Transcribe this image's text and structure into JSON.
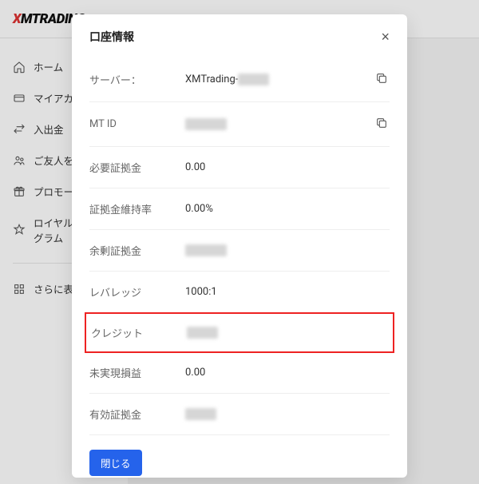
{
  "logo": {
    "prefix": "X",
    "rest": "MTRADING"
  },
  "sidebar": {
    "items": [
      {
        "label": "ホーム",
        "icon": "home-icon"
      },
      {
        "label": "マイアカウント",
        "icon": "account-icon"
      },
      {
        "label": "入出金",
        "icon": "transfer-icon"
      },
      {
        "label": "ご友人を紹介する",
        "icon": "refer-icon"
      },
      {
        "label": "プロモーション",
        "icon": "promo-icon"
      },
      {
        "label": "ロイヤルティプログラム",
        "icon": "loyalty-icon"
      }
    ],
    "more": "さらに表示する"
  },
  "modal": {
    "title": "口座情報",
    "rows": [
      {
        "label": "サーバー：",
        "value": "XMTrading-",
        "blurred_suffix": "xxxxxx",
        "copy": true
      },
      {
        "label": "MT ID",
        "value": "",
        "blurred_suffix": "xxxxxxxx",
        "copy": true
      },
      {
        "label": "必要証拠金",
        "value": "0.00"
      },
      {
        "label": "証拠金維持率",
        "value": "0.00%"
      },
      {
        "label": "余剰証拠金",
        "value": "",
        "blurred_suffix": "xxxxxxxx"
      },
      {
        "label": "レバレッジ",
        "value": "1000:1"
      },
      {
        "label": "クレジット",
        "value": "",
        "blurred_suffix": "xxxxxx",
        "highlight": true
      },
      {
        "label": "未実現損益",
        "value": "0.00"
      },
      {
        "label": "有効証拠金",
        "value": "",
        "blurred_suffix": "xxxxxx"
      }
    ],
    "close": "閉じる"
  }
}
